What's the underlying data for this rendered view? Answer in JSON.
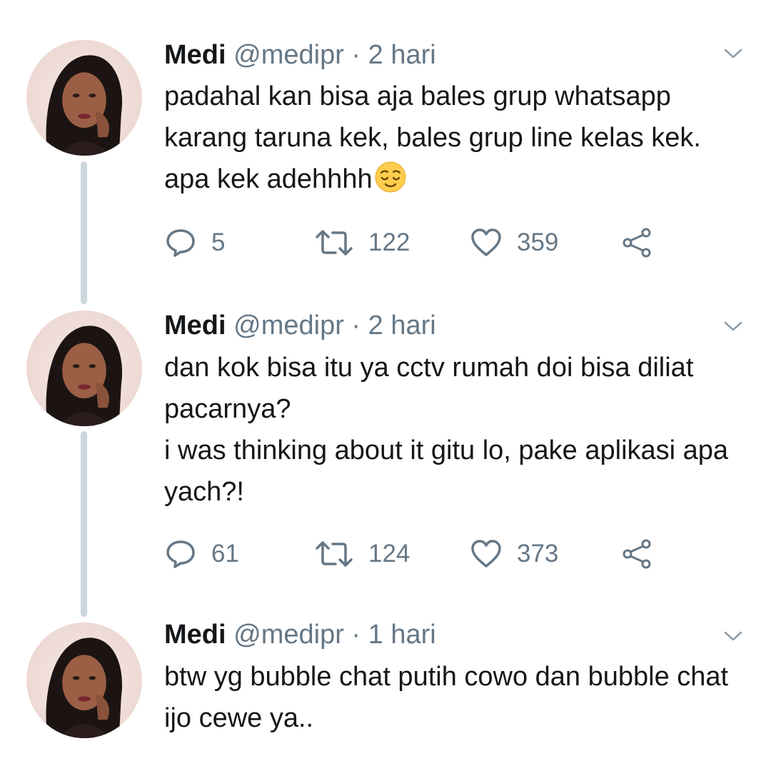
{
  "colors": {
    "text": "#14171a",
    "secondary": "#657786",
    "thread_line": "#ccd6dd"
  },
  "tweets": [
    {
      "name": "Medi",
      "handle": "@medipr",
      "separator": "·",
      "time": "2 hari",
      "lines": [
        "padahal kan bisa aja bales grup whatsapp karang taruna kek, bales grup line kelas kek. apa kek adehhhh"
      ],
      "emoji": "relieved-face-emoji",
      "replies": "5",
      "retweets": "122",
      "likes": "359"
    },
    {
      "name": "Medi",
      "handle": "@medipr",
      "separator": "·",
      "time": "2 hari",
      "lines": [
        "dan kok bisa itu ya cctv rumah doi bisa diliat pacarnya?",
        "i was thinking about it gitu lo, pake aplikasi apa yach?!"
      ],
      "replies": "61",
      "retweets": "124",
      "likes": "373"
    },
    {
      "name": "Medi",
      "handle": "@medipr",
      "separator": "·",
      "time": "1 hari",
      "lines": [
        "btw yg bubble chat putih cowo dan bubble chat ijo cewe ya.."
      ]
    }
  ]
}
